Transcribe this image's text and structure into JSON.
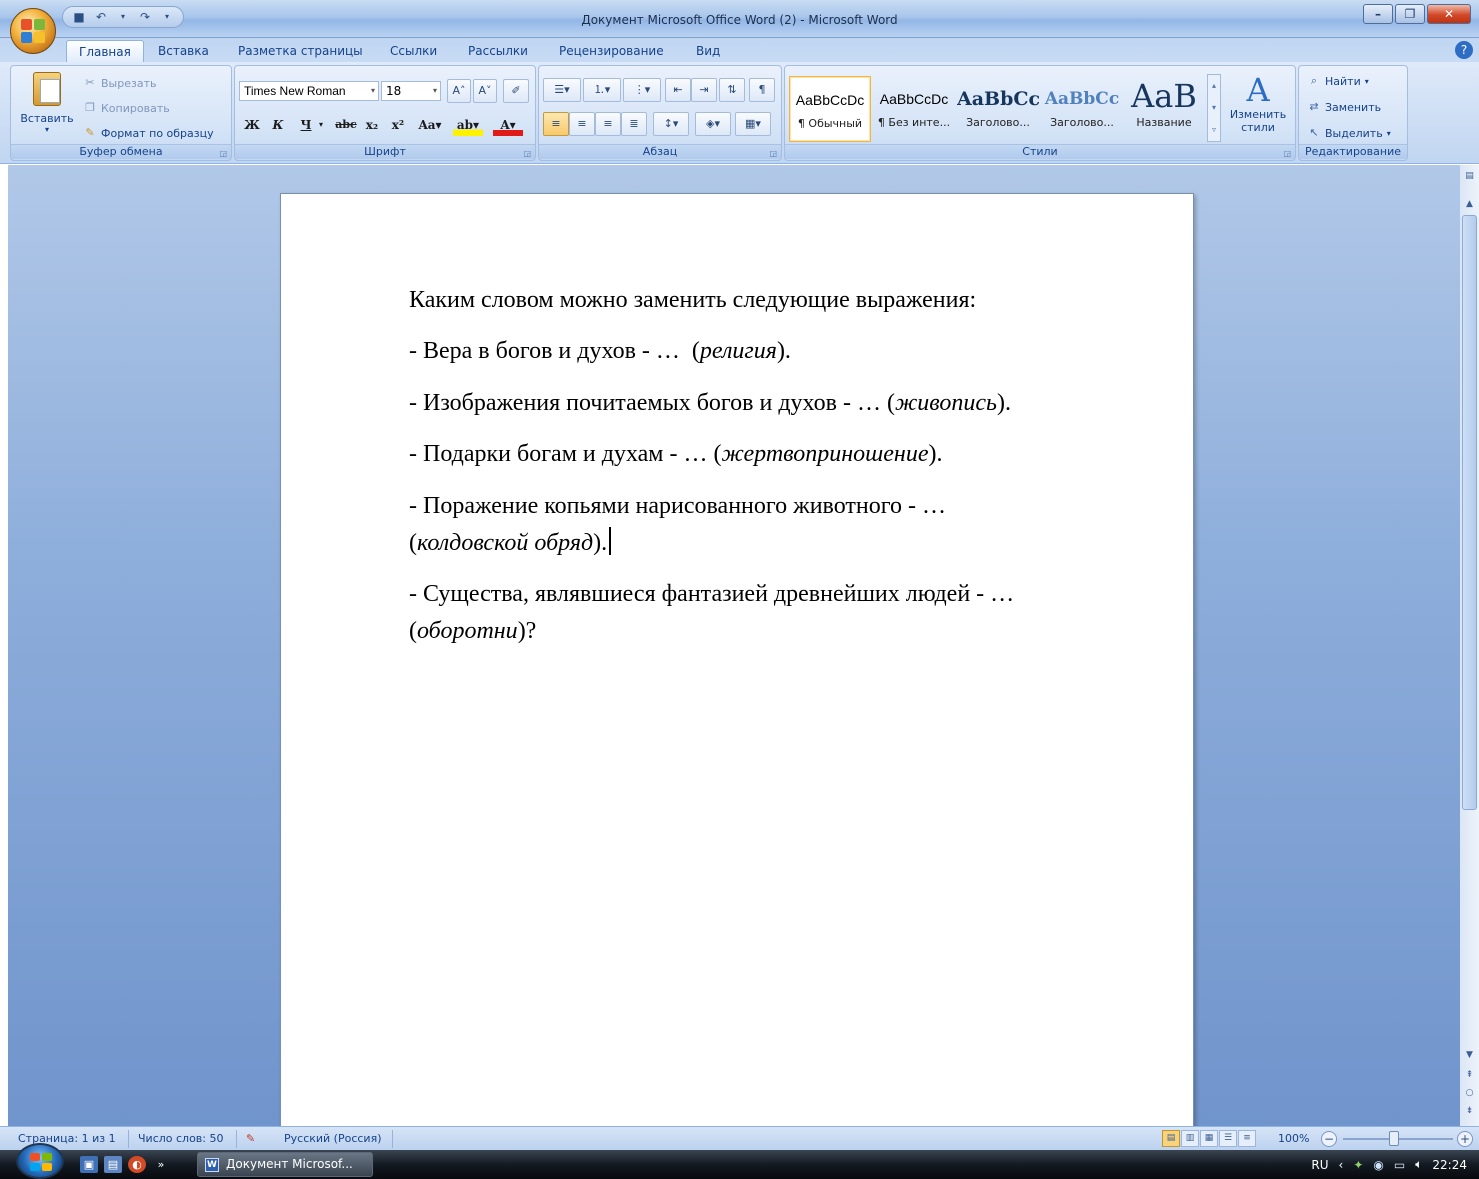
{
  "window": {
    "title": "Документ Microsoft Office Word (2) - Microsoft Word"
  },
  "tabs": [
    "Главная",
    "Вставка",
    "Разметка страницы",
    "Ссылки",
    "Рассылки",
    "Рецензирование",
    "Вид"
  ],
  "active_tab": "Главная",
  "clipboard": {
    "paste": "Вставить",
    "cut": "Вырезать",
    "copy": "Копировать",
    "format_painter": "Формат по образцу",
    "group_label": "Буфер обмена"
  },
  "font": {
    "name": "Times New Roman",
    "size": "18",
    "group_label": "Шрифт"
  },
  "paragraph": {
    "group_label": "Абзац"
  },
  "styles": {
    "items": [
      {
        "preview": "AaBbCcDc",
        "name": "¶ Обычный"
      },
      {
        "preview": "AaBbCcDc",
        "name": "¶ Без инте..."
      },
      {
        "preview": "AaBbCc",
        "name": "Заголово..."
      },
      {
        "preview": "AaBbCc",
        "name": "Заголово..."
      },
      {
        "preview": "AaB",
        "name": "Название"
      }
    ],
    "change_styles": "Изменить стили",
    "group_label": "Стили"
  },
  "editing": {
    "find": "Найти",
    "replace": "Заменить",
    "select": "Выделить",
    "group_label": "Редактирование"
  },
  "document": {
    "p1": "Каким словом можно заменить следующие выражения:",
    "p2_text": "- Вера в богов и духов - …  (",
    "p2_answer": "религия",
    "p2_end": ").",
    "p3_text": "- Изображения почитаемых богов и духов - … (",
    "p3_answer": "живопись",
    "p3_end": ").",
    "p4_text": "- Подарки богам и духам - … (",
    "p4_answer": "жертвоприношение",
    "p4_end": ").",
    "p5_line1": "- Поражение копьями нарисованного животного - …",
    "p5_open": "(",
    "p5_answer": "колдовской обряд",
    "p5_end": ").",
    "p6_line1": "- Существа, являвшиеся фантазией древнейших людей - …",
    "p6_open": "(",
    "p6_answer": "оборотни",
    "p6_end": ")?"
  },
  "status": {
    "page": "Страница: 1 из 1",
    "words": "Число слов: 50",
    "language": "Русский (Россия)",
    "zoom": "100%"
  },
  "taskbar": {
    "item": "Документ Microsof...",
    "lang": "RU",
    "time": "22:24"
  },
  "colors": {
    "ribbon_text": "#15428b",
    "heading_style": "#17365d",
    "heading2_style": "#4f81bd"
  }
}
